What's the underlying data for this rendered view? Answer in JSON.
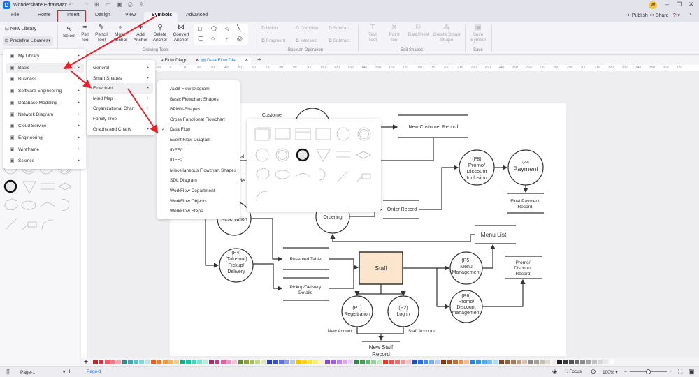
{
  "app": {
    "title": "Wondershare EdrawMax",
    "avatar_letter": "W",
    "publish": "Publish",
    "share": "Share"
  },
  "menu_tabs": [
    "File",
    "Home",
    "Insert",
    "Design",
    "View",
    "Symbols",
    "Advanced"
  ],
  "active_tab": "Symbols",
  "highlighted_tab": "Insert",
  "ribbon": {
    "library": {
      "new": "New Library",
      "predefine": "Predefine Libraries"
    },
    "drawing": [
      {
        "l1": "Select",
        "l2": "",
        "icon": "pointer-icon"
      },
      {
        "l1": "Pen",
        "l2": "Tool",
        "icon": "pen-icon"
      },
      {
        "l1": "Pencil",
        "l2": "Tool",
        "icon": "pencil-icon"
      },
      {
        "l1": "Move",
        "l2": "Anchor",
        "icon": "move-anchor-icon"
      },
      {
        "l1": "Add",
        "l2": "Anchor",
        "icon": "add-anchor-icon"
      },
      {
        "l1": "Delete",
        "l2": "Anchor",
        "icon": "delete-anchor-icon"
      },
      {
        "l1": "Convert",
        "l2": "Anchor",
        "icon": "convert-anchor-icon"
      }
    ],
    "drawing_group": "Drawing Tools",
    "boolean": [
      "Union",
      "Combine",
      "Subtract",
      "Fragment",
      "Intersect",
      "Subtract"
    ],
    "boolean_group": "Boolean Operation",
    "edit": [
      {
        "l1": "Text",
        "l2": "Tool"
      },
      {
        "l1": "Point",
        "l2": "Tool"
      },
      {
        "l1": "DataSheet",
        "l2": ""
      },
      {
        "l1": "Create Smart",
        "l2": "Shape"
      }
    ],
    "edit_group": "Edit Shapes",
    "save": {
      "l1": "Save",
      "l2": "Symbol"
    },
    "save_group": "Save"
  },
  "doc_tabs": [
    {
      "label": "a Flow Diagr..."
    },
    {
      "label": "Data Flow Dia...",
      "active": true
    }
  ],
  "ruler_labels": [
    "-10",
    "0",
    "10",
    "20",
    "30",
    "40",
    "50",
    "60",
    "70",
    "80",
    "90",
    "100",
    "110",
    "120",
    "130",
    "140",
    "150",
    "160",
    "170",
    "180",
    "190",
    "200",
    "210",
    "220",
    "230",
    "240",
    "250",
    "260",
    "270",
    "280",
    "290",
    "300",
    "310",
    "320",
    "330",
    "340",
    "350",
    "360",
    "370"
  ],
  "menu1": [
    {
      "label": "My Library",
      "icon": "library-icon"
    },
    {
      "label": "Basic",
      "icon": "tag-icon",
      "hl": true
    },
    {
      "label": "Business",
      "icon": "business-icon"
    },
    {
      "label": "Software Engineering",
      "icon": "software-icon"
    },
    {
      "label": "Database Modeling",
      "icon": "database-icon"
    },
    {
      "label": "Network Diagram",
      "icon": "network-icon"
    },
    {
      "label": "Cloud Service",
      "icon": "cloud-icon"
    },
    {
      "label": "Engineering",
      "icon": "helmet-icon"
    },
    {
      "label": "Wireframe",
      "icon": "wireframe-icon"
    },
    {
      "label": "Science",
      "icon": "flask-icon"
    }
  ],
  "menu2": [
    {
      "label": "General",
      "arrow": true
    },
    {
      "label": "Smart Shapes",
      "arrow": true
    },
    {
      "label": "Flowchart",
      "arrow": true,
      "hl": true
    },
    {
      "label": "Mind Map",
      "arrow": true
    },
    {
      "label": "Organizational Chart",
      "arrow": true
    },
    {
      "label": "Family Tree",
      "arrow": false
    },
    {
      "label": "Graphs and Charts",
      "arrow": true
    }
  ],
  "menu3": [
    {
      "label": "Audit Flow Diagram"
    },
    {
      "label": "Basic Flowchart Shapes"
    },
    {
      "label": "BPMN-Shapes"
    },
    {
      "label": "Cross Functional Flowchart"
    },
    {
      "label": "Data Flow",
      "checked": true
    },
    {
      "label": "Event Flow Diagram"
    },
    {
      "label": "IDEF0"
    },
    {
      "label": "IDEF2"
    },
    {
      "label": "Miscellaneous Flowchart Shapes"
    },
    {
      "label": "SDL Diagram"
    },
    {
      "label": "WorkFlow Department"
    },
    {
      "label": "WorkFlow Objects"
    },
    {
      "label": "WorkFlow Steps"
    }
  ],
  "diagram": {
    "customer": "Customer",
    "new_customer_record": "New Customer Record",
    "approval_frag": "val",
    "order_frag": "rde",
    "p8": [
      "(P8)",
      "Promo/",
      "Discount",
      "Inclusion"
    ],
    "p9": [
      "(P9)",
      "Payment"
    ],
    "final_payment": [
      "Final Payment",
      "Record"
    ],
    "order_record": "Order Record",
    "ordering": [
      "(P",
      ")",
      "Ordering"
    ],
    "reservation": "Reservation",
    "menu_list": "Menu List",
    "p4": [
      "(P4)",
      "(Take out)",
      "Pickup/",
      "Delivery"
    ],
    "reserved_table": "Reserved Table",
    "pickup_details": [
      "Pickup/Delivery",
      "Details"
    ],
    "staff": "Staff",
    "p5": [
      "(P5)",
      "Menu",
      "Management"
    ],
    "p6": [
      "(P6)",
      "Promo/",
      "Discount",
      "management"
    ],
    "promo_record": [
      "Promo/",
      "Discount",
      "Record"
    ],
    "p1": [
      "(P1)",
      "Registration"
    ],
    "p2": [
      "(P2)",
      "Log in"
    ],
    "new_account": "New Acount",
    "staff_account": "Staff Account",
    "new_staff_record": [
      "New Staff",
      "Record"
    ],
    "staff_fill": "#fce5cd"
  },
  "palette": [
    "#c0282d",
    "#d9323c",
    "#f05a6a",
    "#f47a8a",
    "#f9a3b0",
    "#2e8b9a",
    "#3aa6b9",
    "#4fc3d6",
    "#7fd6e3",
    "#b5e8ef",
    "#f05a24",
    "#f6772e",
    "#f99a2e",
    "#fbb24a",
    "#fcc97a",
    "#1fa88a",
    "#26bfa0",
    "#4fd3b8",
    "#7fe0cc",
    "#b2eee0",
    "#a0306a",
    "#c23e84",
    "#d966a3",
    "#e899c2",
    "#f2c4dc",
    "#6b8e23",
    "#86a832",
    "#a4c34a",
    "#c2d97a",
    "#dcebb0",
    "#2c3fb8",
    "#3a55d4",
    "#5b74e6",
    "#8a9cf0",
    "#b9c4f6",
    "#f6c400",
    "#fad21e",
    "#fbe04a",
    "#fcea7f",
    "#fdf3b5",
    "#8e44d6",
    "#a65ee6",
    "#c084f0",
    "#d6aaf5",
    "#e9d0fa",
    "#2e8b3e",
    "#3ea350",
    "#5fbf70",
    "#8fd69c",
    "#c0eac7",
    "#e53935",
    "#ef5350",
    "#f36c6c",
    "#f79494",
    "#fbc0c0",
    "#1e4fb8",
    "#2f6bd9",
    "#4f8ae8",
    "#7fa9f0",
    "#b3cdf7",
    "#8b3a0f",
    "#a8501e",
    "#c66d36",
    "#dc9266",
    "#eebd9e",
    "#1e88e5",
    "#2a9cf0",
    "#45b0f5",
    "#6fc6f8",
    "#a8ddfb",
    "#7b4a2e",
    "#95603e",
    "#ad7a58",
    "#c69a7c",
    "#dcbfa8",
    "#8d8d8d",
    "#a8a196",
    "#c6c2b3",
    "#dedad0",
    "#f0ede4",
    "#222222",
    "#3a3a3a",
    "#555555",
    "#6e6e6e",
    "#8a8a8a",
    "#a5a5a5",
    "#bfbfbf",
    "#d6d6d6",
    "#e8e8e8",
    "#ffffff"
  ],
  "status": {
    "page_select": "Page-1",
    "page_tab": "Page-1",
    "focus": "Focus",
    "zoom": "100%",
    "zoom_level": 100
  },
  "accent": "#1a73e8",
  "annotation_color": "#e8222a"
}
